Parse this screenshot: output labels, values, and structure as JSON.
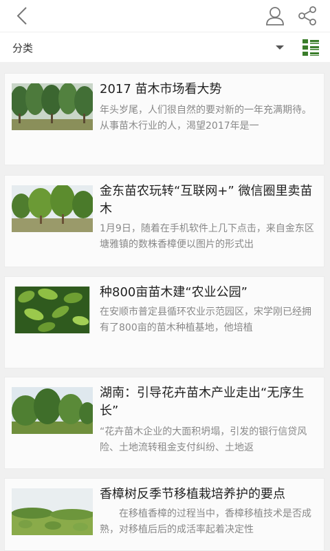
{
  "header": {
    "back_icon": "chevron-left-icon",
    "user_icon": "user-icon",
    "share_icon": "share-icon"
  },
  "filter": {
    "label": "分类",
    "dropdown_icon": "caret-down-icon",
    "view_icon": "list-view-icon",
    "accent_color": "#3a7d2a"
  },
  "articles": [
    {
      "title": "2017 苗木市场看大势",
      "summary": "年头岁尾，人们很自然的要对新的一年充满期待。从事苗木行业的人，渴望2017年是一"
    },
    {
      "title": "金东苗农玩转“互联网+” 微信圈里卖苗木",
      "summary": "1月9日，随着在手机软件上几下点击，来自金东区塘雅镇的数株香樟便以图片的形式出"
    },
    {
      "title": "种800亩苗木建“农业公园”",
      "summary": "在安顺市普定县循环农业示范园区，宋学刚已经拥有了800亩的苗木种植基地，他培植"
    },
    {
      "title": "湖南：引导花卉苗木产业走出“无序生长”",
      "summary": "“花卉苗木企业的大面积坍塌，引发的银行信贷风险、土地流转租金支付纠纷、土地返"
    },
    {
      "title": "香樟树反季节移植栽培养护的要点",
      "summary": "　　在移植香樟的过程当中，香樟移植技术是否成熟，对移植后后的成活率起着决定性"
    }
  ]
}
